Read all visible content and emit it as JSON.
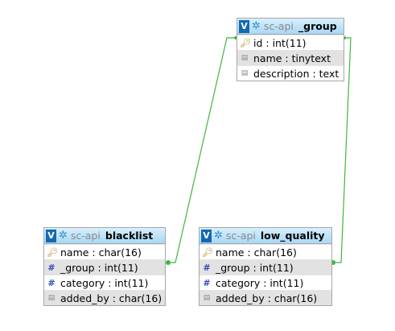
{
  "colors": {
    "header_gradient_top": "#d9effc",
    "header_gradient_bottom": "#a9d8f5",
    "toggle": "#1269b2",
    "relation_line": "#3fb63f",
    "alt_row": "#e2e2e2",
    "border": "#a7a7a7"
  },
  "tables": {
    "group": {
      "toggle": "V",
      "db": "sc-api",
      "name": "_group",
      "columns": [
        {
          "text": "id : int(11)",
          "icon": "key-icon"
        },
        {
          "text": "name : tinytext",
          "icon": "field-icon"
        },
        {
          "text": "description : text",
          "icon": "field-icon"
        }
      ]
    },
    "blacklist": {
      "toggle": "V",
      "db": "sc-api",
      "name": "blacklist",
      "columns": [
        {
          "text": "name : char(16)",
          "icon": "key-icon"
        },
        {
          "text": "_group : int(11)",
          "icon": "hash-icon"
        },
        {
          "text": "category : int(11)",
          "icon": "hash-icon"
        },
        {
          "text": "added_by : char(16)",
          "icon": "field-icon"
        }
      ]
    },
    "low_quality": {
      "toggle": "V",
      "db": "sc-api",
      "name": "low_quality",
      "columns": [
        {
          "text": "name : char(16)",
          "icon": "key-icon"
        },
        {
          "text": "_group : int(11)",
          "icon": "hash-icon"
        },
        {
          "text": "category : int(11)",
          "icon": "hash-icon"
        },
        {
          "text": "added_by : char(16)",
          "icon": "field-icon"
        }
      ]
    }
  },
  "relations": [
    {
      "from": "blacklist._group",
      "to": "_group.id"
    },
    {
      "from": "low_quality._group",
      "to": "_group.id"
    }
  ]
}
